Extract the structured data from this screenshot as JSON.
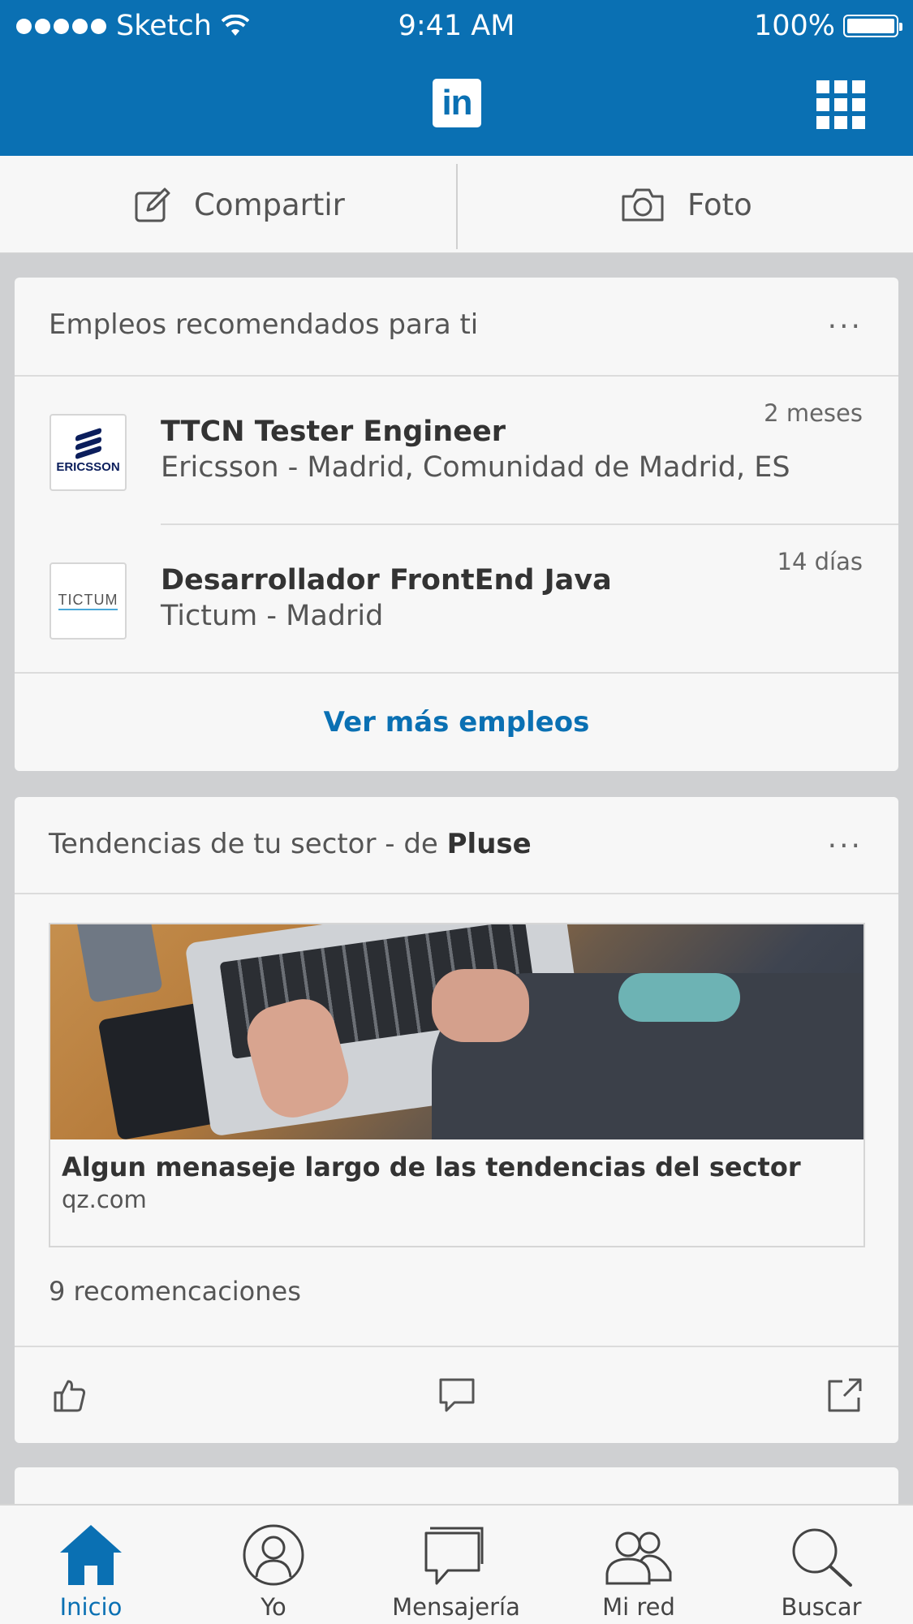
{
  "status_bar": {
    "carrier": "Sketch",
    "time": "9:41 AM",
    "battery": "100%"
  },
  "header": {
    "logo_text": "in"
  },
  "share": {
    "compartir_label": "Compartir",
    "foto_label": "Foto"
  },
  "jobs_card": {
    "title": "Empleos recomendados para ti",
    "more": "...",
    "jobs": [
      {
        "title": "TTCN Tester Engineer",
        "company": "Ericsson - Madrid, Comunidad de Madrid, ES",
        "age": "2 meses",
        "logo_text": "ERICSSON"
      },
      {
        "title": "Desarrollador FrontEnd Java",
        "company": "Tictum - Madrid",
        "age": "14 días",
        "logo_text": "TICTUM"
      }
    ],
    "see_more": "Ver más empleos"
  },
  "trends_card": {
    "title_prefix": "Tendencias de tu sector - de ",
    "title_source": "Pluse",
    "more": "...",
    "article_title": "Algun menaseje largo de las tendencias del sector",
    "article_source": "qz.com",
    "recommendations": "9 recomencaciones"
  },
  "tabs": [
    {
      "label": "Inicio",
      "icon": "home-icon",
      "active": true
    },
    {
      "label": "Yo",
      "icon": "profile-icon",
      "active": false
    },
    {
      "label": "Mensajería",
      "icon": "messaging-icon",
      "active": false
    },
    {
      "label": "Mi red",
      "icon": "network-icon",
      "active": false
    },
    {
      "label": "Buscar",
      "icon": "search-icon",
      "active": false
    }
  ],
  "colors": {
    "brand": "#0a70b3",
    "background": "#cfd0d2",
    "card": "#f7f7f7"
  }
}
